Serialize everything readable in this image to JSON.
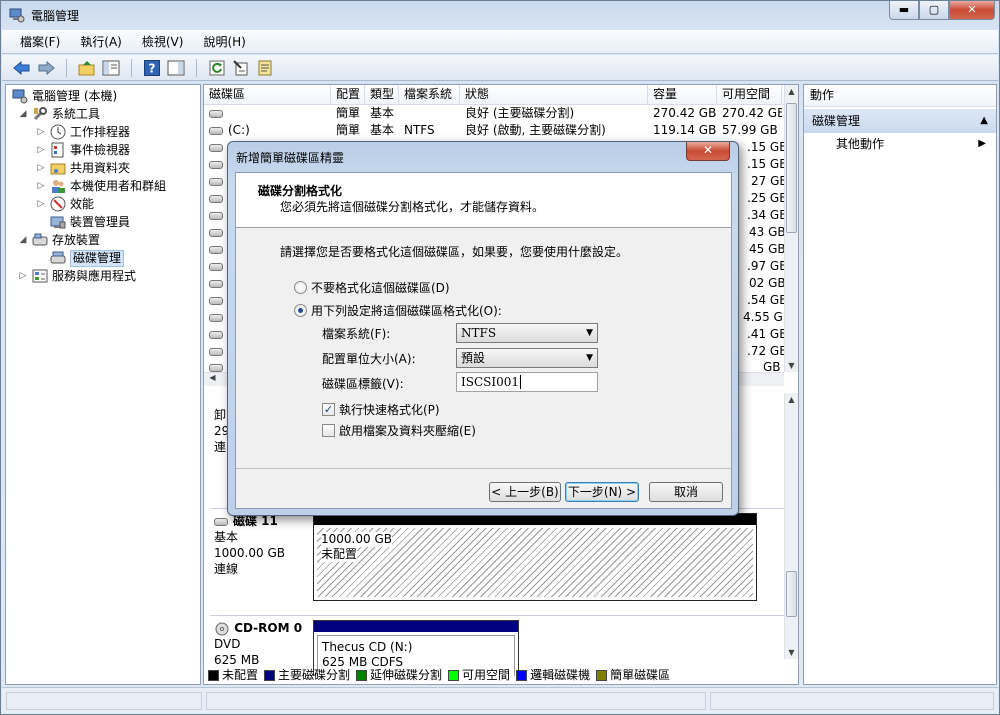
{
  "window": {
    "title": "電腦管理"
  },
  "window_controls": {
    "minimize": "▬",
    "maximize": "▢",
    "close": "✕"
  },
  "menu": [
    "檔案(F)",
    "執行(A)",
    "檢視(V)",
    "說明(H)"
  ],
  "tree": {
    "root": "電腦管理 (本機)",
    "system_tools": "系統工具",
    "task_scheduler": "工作排程器",
    "event_viewer": "事件檢視器",
    "shared_folders": "共用資料夾",
    "local_users": "本機使用者和群組",
    "performance": "效能",
    "device_manager": "裝置管理員",
    "storage": "存放裝置",
    "disk_management": "磁碟管理",
    "services": "服務與應用程式"
  },
  "volumes": {
    "headers": [
      "磁碟區",
      "配置",
      "類型",
      "檔案系統",
      "狀態",
      "容量",
      "可用空間"
    ],
    "rows": [
      {
        "volume": "",
        "layout": "簡單",
        "type": "基本",
        "fs": "",
        "status": "良好 (主要磁碟分割)",
        "capacity": "270.42 GB",
        "free": "270.42 GB"
      },
      {
        "volume": "(C:)",
        "layout": "簡單",
        "type": "基本",
        "fs": "NTFS",
        "status": "良好 (啟動, 主要磁碟分割)",
        "capacity": "119.14 GB",
        "free": "57.99 GB"
      }
    ],
    "free_partial": [
      ".15 GB",
      ".15 GB",
      "27 GB",
      ".25 GB",
      ".34 GB",
      "43 GB",
      "45 GB",
      ".97 GB",
      "02 GB",
      ".54 GB",
      "4.55 GB",
      ".41 GB",
      ".72 GB",
      "GB"
    ]
  },
  "disks": {
    "disk_partial": {
      "line1": "卸",
      "line2": "29",
      "line3": "連"
    },
    "disk11": {
      "name": "磁碟 11",
      "type": "基本",
      "size": "1000.00 GB",
      "status": "連線",
      "part_size": "1000.00 GB",
      "part_status": "未配置"
    },
    "cdrom": {
      "name": "CD-ROM 0",
      "type": "DVD",
      "size": "625 MB",
      "part_name": "Thecus CD  (N:)",
      "part_fs": "625 MB CDFS"
    }
  },
  "legend": [
    {
      "label": "未配置",
      "color": "#000000"
    },
    {
      "label": "主要磁碟分割",
      "color": "#000080"
    },
    {
      "label": "延伸磁碟分割",
      "color": "#008000"
    },
    {
      "label": "可用空間",
      "color": "#00ff00"
    },
    {
      "label": "邏輯磁碟機",
      "color": "#0000ff"
    },
    {
      "label": "簡單磁碟區",
      "color": "#808000"
    }
  ],
  "actions": {
    "header": "動作",
    "group": "磁碟管理",
    "more": "其他動作"
  },
  "dialog": {
    "title": "新增簡單磁碟區精靈",
    "close": "✕",
    "heading": "磁碟分割格式化",
    "subheading": "您必須先將這個磁碟分割格式化，才能儲存資料。",
    "prompt": "請選擇您是否要格式化這個磁碟區，如果要，您要使用什麼設定。",
    "option_no_format": "不要格式化這個磁碟區(D)",
    "option_format": "用下列設定將這個磁碟區格式化(O):",
    "fs_label": "檔案系統(F):",
    "fs_value": "NTFS",
    "alloc_label": "配置單位大小(A):",
    "alloc_value": "預設",
    "vol_label_label": "磁碟區標籤(V):",
    "vol_label_value": "ISCSI001",
    "quick_format": "執行快速格式化(P)",
    "compression": "啟用檔案及資料夾壓縮(E)",
    "back": "< 上一步(B)",
    "next": "下一步(N) >",
    "cancel": "取消"
  }
}
